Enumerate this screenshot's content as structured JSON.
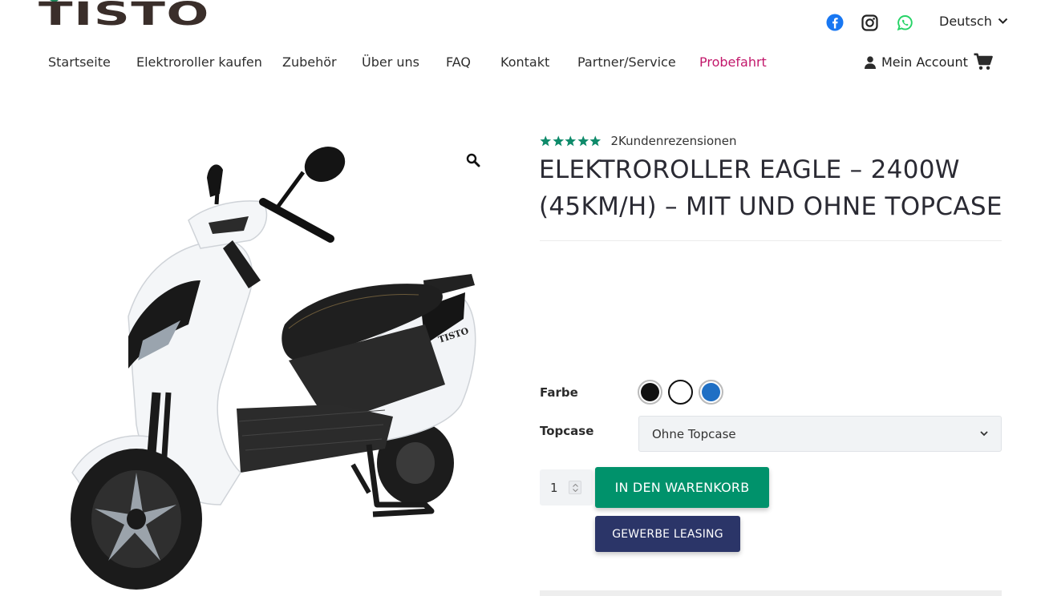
{
  "brand": {
    "logo_text": "TISTO",
    "logo_accent_color": "#1a8a5c",
    "logo_color": "#3a2e2a"
  },
  "header": {
    "social": [
      {
        "icon": "facebook-icon",
        "color": "#1877f2"
      },
      {
        "icon": "instagram-icon",
        "color": "#222222"
      },
      {
        "icon": "whatsapp-icon",
        "color": "#25d366"
      }
    ],
    "language": "Deutsch",
    "account_label": "Mein Account"
  },
  "nav": {
    "items": [
      {
        "label": "Startseite"
      },
      {
        "label": "Elektroroller kaufen"
      },
      {
        "label": "Zubehör"
      },
      {
        "label": "Über uns"
      },
      {
        "label": "FAQ"
      },
      {
        "label": "Kontakt"
      },
      {
        "label": "Partner/Service"
      },
      {
        "label": "Probefahrt",
        "highlight_color": "#c2186b"
      }
    ]
  },
  "product": {
    "rating": 5,
    "rating_max": 5,
    "star_color": "#0e8a6a",
    "reviews_text": "2Kundenrezensionen",
    "title_line1": "ELEKTROROLLER EAGLE – 2400W",
    "title_line2": "(45KM/H) – MIT UND OHNE TOPCASE",
    "color_label": "Farbe",
    "colors": [
      {
        "name": "Schwarz",
        "hex": "#111111"
      },
      {
        "name": "Weiß",
        "hex": "#ffffff",
        "selected": true
      },
      {
        "name": "Blau",
        "hex": "#1f6fc4"
      }
    ],
    "topcase_label": "Topcase",
    "topcase_selected": "Ohne Topcase",
    "quantity": "1",
    "add_to_cart_label": "IN DEN WARENKORB",
    "add_to_cart_color": "#00926b",
    "leasing_label": "GEWERBE LEASING",
    "leasing_color": "#2b3568",
    "image_logo_text": "TISTO"
  }
}
